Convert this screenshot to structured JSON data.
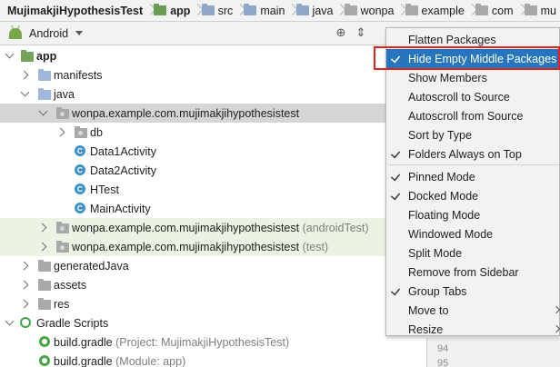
{
  "breadcrumb": [
    "MujimakjiHypothesisTest",
    "app",
    "src",
    "main",
    "java",
    "wonpa",
    "example",
    "com",
    "mu"
  ],
  "toolbar": {
    "view_mode": "Android"
  },
  "tree": {
    "app": "app",
    "manifests": "manifests",
    "java": "java",
    "pkg_main": "wonpa.example.com.mujimakjihypothesistest",
    "db": "db",
    "data1": "Data1Activity",
    "data2": "Data2Activity",
    "htest": "HTest",
    "main_activity": "MainActivity",
    "pkg_android_test": "wonpa.example.com.mujimakjihypothesistest",
    "pkg_android_test_suffix": "(androidTest)",
    "pkg_test": "wonpa.example.com.mujimakjihypothesistest",
    "pkg_test_suffix": "(test)",
    "generated_java": "generatedJava",
    "assets": "assets",
    "res": "res",
    "gradle_scripts": "Gradle Scripts",
    "build_gradle_1": "build.gradle",
    "build_gradle_1_suffix": "(Project: MujimakjiHypothesisTest)",
    "build_gradle_2": "build.gradle",
    "build_gradle_2_suffix": "(Module: app)",
    "class_letter": "C"
  },
  "editor": {
    "line_numbers": [
      "94",
      "95"
    ]
  },
  "menu": {
    "items": [
      {
        "label": "Flatten Packages",
        "checked": false
      },
      {
        "label": "Hide Empty Middle Packages",
        "checked": true,
        "highlighted": true
      },
      {
        "label": "Show Members",
        "checked": false
      },
      {
        "label": "Autoscroll to Source",
        "checked": false
      },
      {
        "label": "Autoscroll from Source",
        "checked": false
      },
      {
        "label": "Sort by Type",
        "checked": false
      },
      {
        "label": "Folders Always on Top",
        "checked": true
      },
      {
        "label": "Pinned Mode",
        "checked": true
      },
      {
        "label": "Docked Mode",
        "checked": true
      },
      {
        "label": "Floating Mode",
        "checked": false
      },
      {
        "label": "Windowed Mode",
        "checked": false
      },
      {
        "label": "Split Mode",
        "checked": false
      },
      {
        "label": "Remove from Sidebar",
        "checked": false
      },
      {
        "label": "Group Tabs",
        "checked": true
      },
      {
        "label": "Move to",
        "checked": false,
        "submenu": true
      },
      {
        "label": "Resize",
        "checked": false,
        "submenu": true
      }
    ]
  },
  "colors": {
    "highlight": "#2675bf",
    "selection_row": "#d5d5d5",
    "test_row": "#ebf3e4",
    "annotation_box": "#e0231c"
  }
}
